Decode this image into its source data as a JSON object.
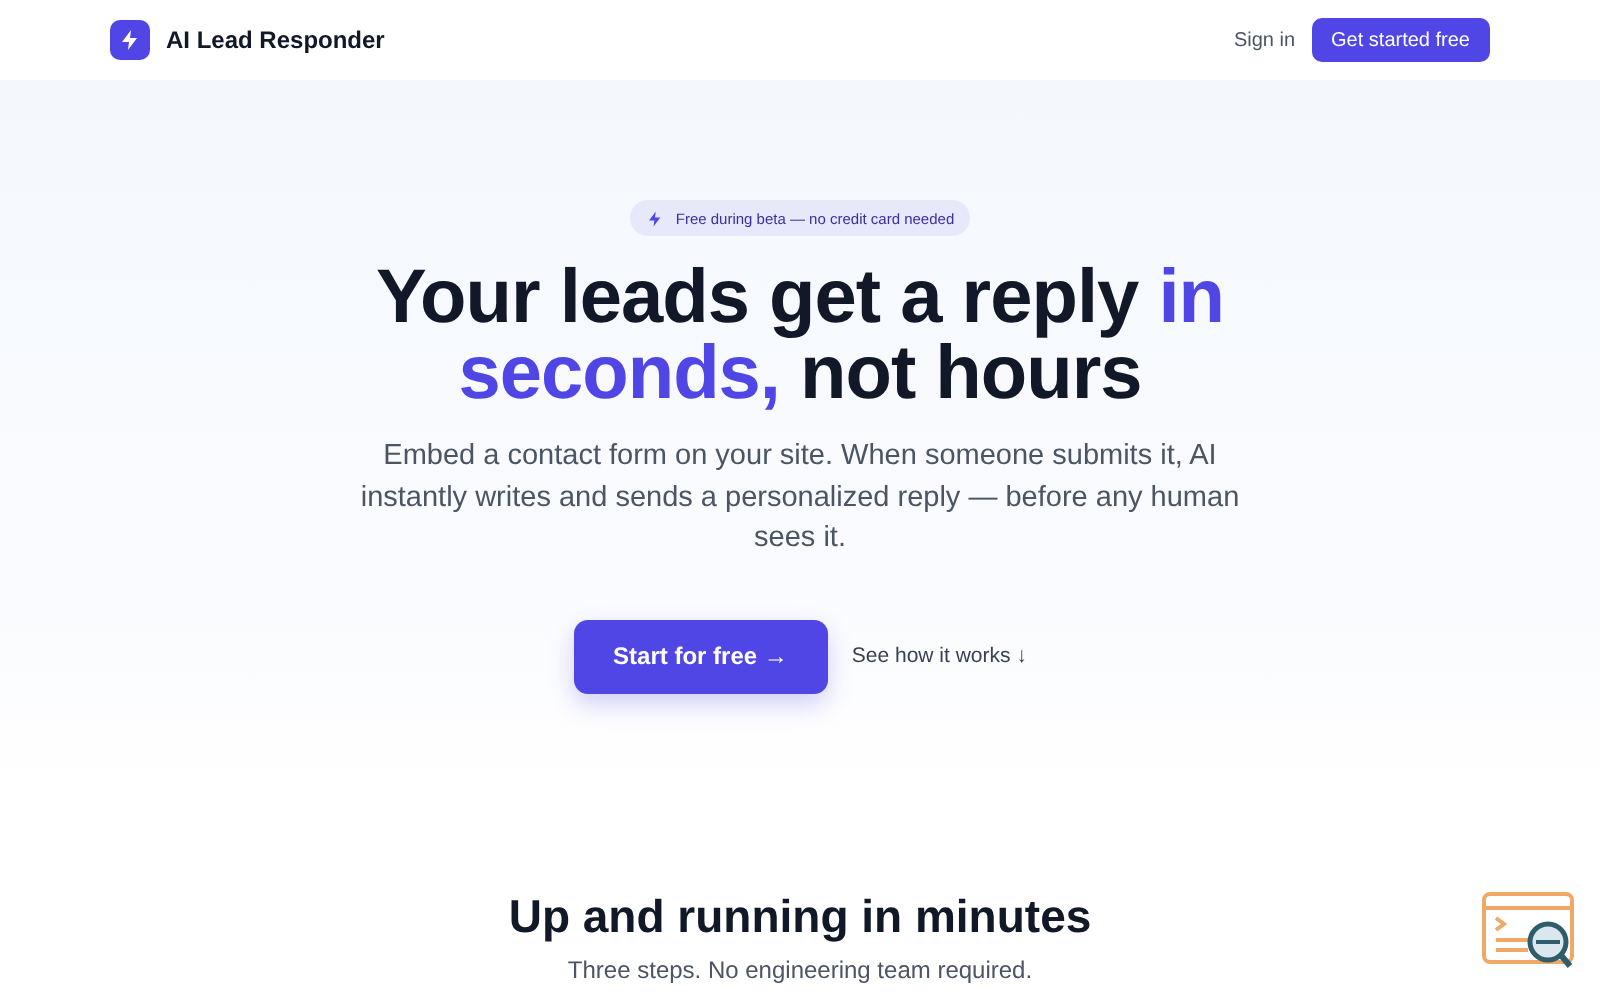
{
  "nav": {
    "brand": "AI Lead Responder",
    "links": [
      {
        "label": "Sign in",
        "kind": "link"
      },
      {
        "label": "Get started free",
        "kind": "button"
      }
    ]
  },
  "hero": {
    "badge": "Free during beta — no credit card needed",
    "headline": [
      {
        "text": "Your leads get a reply ",
        "accent": false
      },
      {
        "text": "in seconds,",
        "accent": true
      },
      {
        "text": " not hours",
        "accent": false
      }
    ],
    "subtitle": "Embed a contact form on your site. When someone submits it, AI instantly writes and sends a personalized reply — before any human sees it.",
    "actions": [
      {
        "label": "Start for free →",
        "kind": "primary"
      },
      {
        "label": "See how it works ↓",
        "kind": "link"
      }
    ]
  },
  "steps_section": {
    "title": "Up and running in minutes",
    "subtitle": "Three steps. No engineering team required."
  }
}
